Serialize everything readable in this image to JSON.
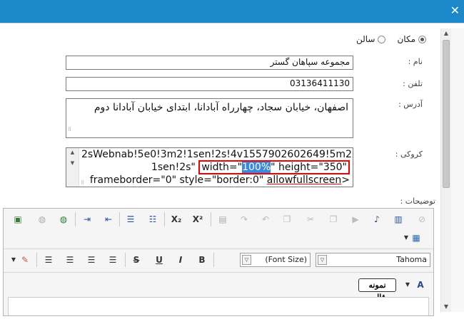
{
  "window": {
    "close_glyph": "✕"
  },
  "location_type": {
    "options": [
      {
        "label": "مکان",
        "checked": true
      },
      {
        "label": "سالن",
        "checked": false
      }
    ]
  },
  "labels": {
    "name": "نام :",
    "phone": "تلفن :",
    "address": "آدرس :",
    "map": "کروکی :",
    "description": "توضیحات :"
  },
  "fields": {
    "name_value": "مجموعه سپاهان گستر",
    "phone_value": "03136411130",
    "address_value": "اصفهان، خیابان سجاد، چهارراه آبادانا، ابتدای خیابان آبادانا دوم"
  },
  "map_code": {
    "line1": "2sWebnab!5e0!3m2!1sen!2s!4v1557902602649!5m2!",
    "line2_pre": "1sen!2s\"",
    "hl_width_attr": "width=\"",
    "hl_width_val": "100%",
    "hl_height_attr": "\" height=\"",
    "hl_height_val": "350",
    "hl_quote": "\"",
    "line3_a": "frameborder=\"0\" style=\"border:0\"",
    "line3_b": "allowfullscreen",
    "line3_c": ">"
  },
  "editor": {
    "font_size_label": "(Font Size)",
    "font_name": "Tahoma",
    "template_button": "نمونه قالب",
    "icons_row1": [
      "image-icon",
      "globe-disabled-icon",
      "globe-link-icon",
      "indent-icon",
      "outdent-icon",
      "bullet-list-icon",
      "numbered-list-icon",
      "subscript-icon",
      "superscript-icon",
      "paste-icon",
      "redo-icon",
      "undo-icon",
      "cut-icon",
      "copy-icon",
      "youtube-icon",
      "music-icon",
      "film-icon",
      "disabled-icon"
    ],
    "glyphs": {
      "subscript": "X₂",
      "superscript": "X²",
      "strike": "S",
      "underline": "U",
      "bold": "B",
      "font_color": "A"
    }
  }
}
